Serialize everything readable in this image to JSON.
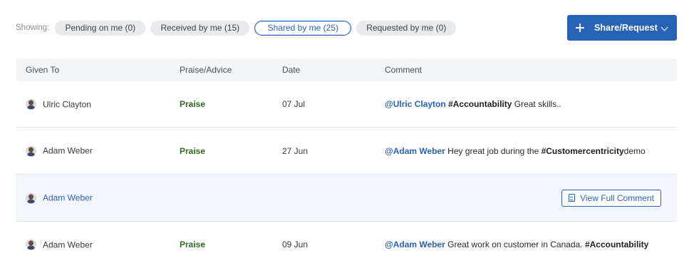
{
  "filters": {
    "showing_label": "Showing:",
    "pills": [
      {
        "label": "Pending on me (0)",
        "active": false
      },
      {
        "label": "Received by me (15)",
        "active": false
      },
      {
        "label": "Shared by me (25)",
        "active": true
      },
      {
        "label": "Requested by me (0)",
        "active": false
      }
    ]
  },
  "share_button": {
    "label": "Share/Request",
    "icon": "plus-icon",
    "dropdown_icon": "chevron-down-icon"
  },
  "colors": {
    "accent": "#2762b7",
    "praise": "#2e6b1f",
    "header_bg": "#f4f5f7",
    "highlight_row": "#f3f7fc"
  },
  "table": {
    "columns": [
      "Given To",
      "Praise/Advice",
      "Date",
      "Comment"
    ],
    "rows": [
      {
        "given_to": "Ulric Clayton",
        "type": "Praise",
        "date": "07 Jul",
        "comment": {
          "mention": "@Ulric Clayton",
          "tag": "#Accountability",
          "text": " Great skills.."
        }
      },
      {
        "given_to": "Adam Weber",
        "type": "Praise",
        "date": "27 Jun",
        "comment": {
          "mention": "@Adam Weber",
          "text": " Hey great job during the ",
          "tag": "#Customercentricity",
          "text_after": "demo"
        }
      },
      {
        "given_to": "Adam Weber",
        "type": "",
        "date": "",
        "view_full_comment": "View Full Comment"
      },
      {
        "given_to": "Adam Weber",
        "type": "Praise",
        "date": "09 Jun",
        "comment": {
          "mention": "@Adam Weber",
          "text": " Great work on customer in Canada. ",
          "tag": "#Accountability"
        }
      }
    ]
  }
}
